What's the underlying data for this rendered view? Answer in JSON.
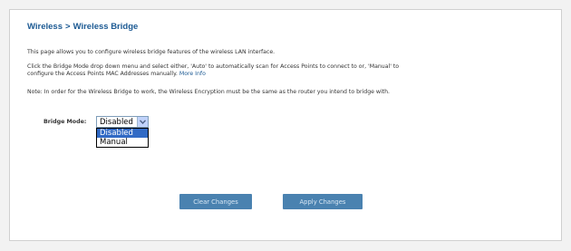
{
  "breadcrumb": {
    "section": "Wireless",
    "separator": ">",
    "page": "Wireless Bridge"
  },
  "description": "This page allows you to configure wireless bridge features of the wireless LAN interface.",
  "instructions": {
    "line1": "Click the Bridge Mode drop down menu and select either, 'Auto' to automatically scan for Access Points to connect to or, 'Manual' to",
    "line2": "configure the Access Points MAC Addresses manually.",
    "more_info": "More Info"
  },
  "note": "Note: In order for the Wireless Bridge to work, the Wireless Encryption must be the same as the router you intend to bridge with.",
  "bridge_mode": {
    "label": "Bridge Mode:",
    "selected": "Disabled",
    "options": [
      "Disabled",
      "Manual"
    ]
  },
  "buttons": {
    "clear": "Clear Changes",
    "apply": "Apply Changes"
  },
  "colors": {
    "accent": "#1c5a93",
    "button": "#4a82b0",
    "selection": "#316ac5"
  }
}
